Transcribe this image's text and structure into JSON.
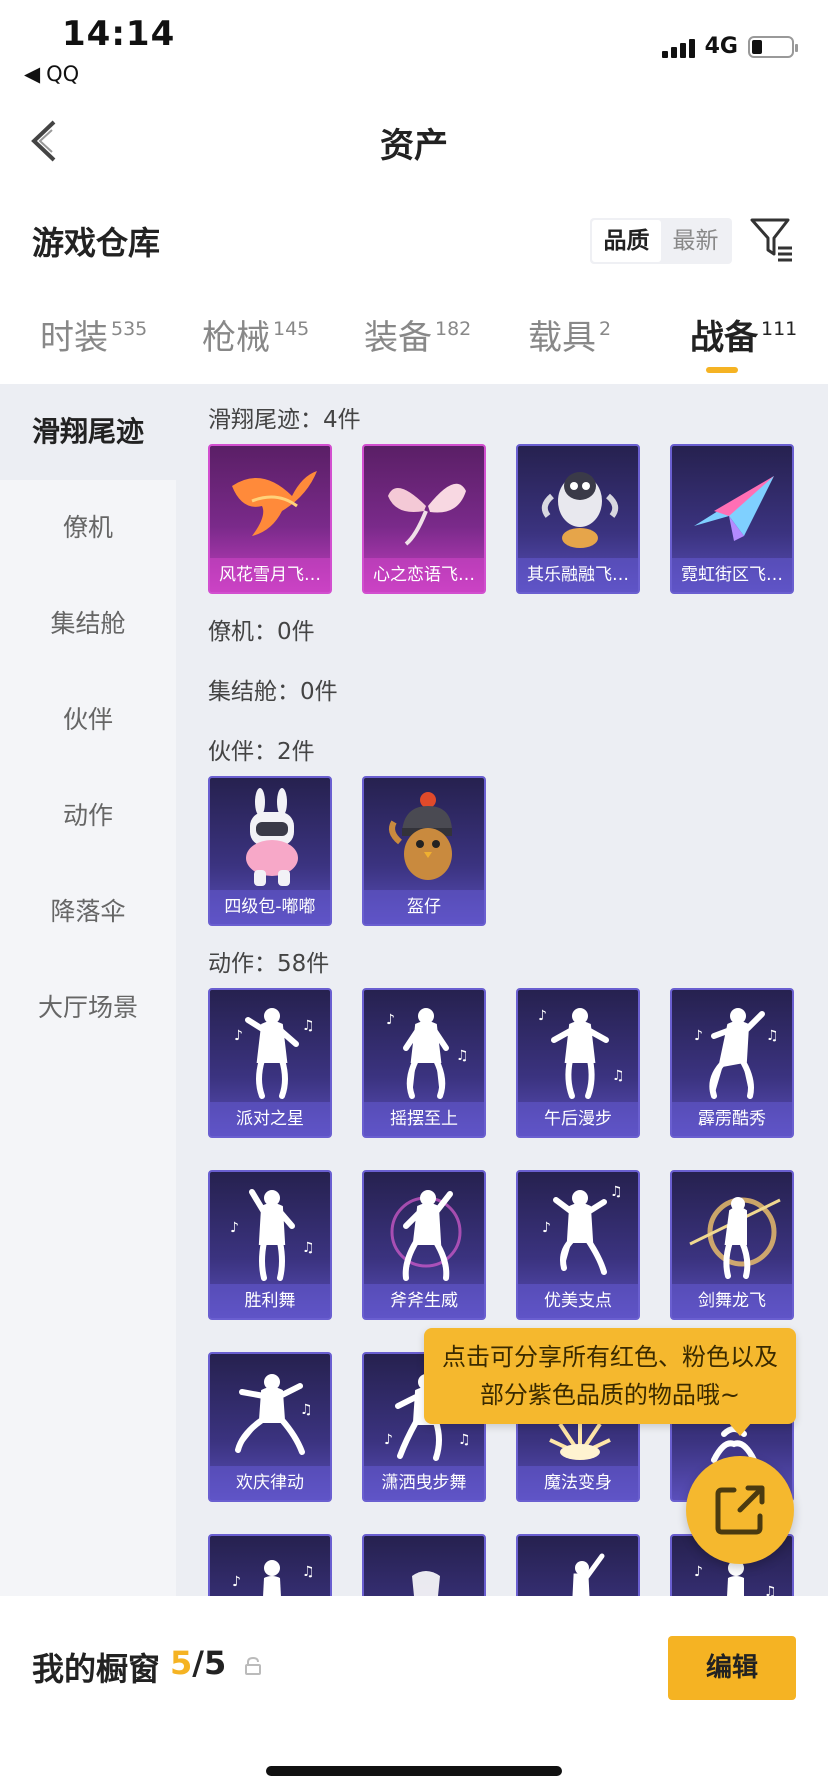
{
  "status": {
    "time": "14:14",
    "back_app": "QQ",
    "network": "4G"
  },
  "nav": {
    "title": "资产"
  },
  "header": {
    "title": "游戏仓库",
    "sort_options": [
      "品质",
      "最新"
    ]
  },
  "tabs": [
    {
      "label": "时装",
      "count": "535"
    },
    {
      "label": "枪械",
      "count": "145"
    },
    {
      "label": "装备",
      "count": "182"
    },
    {
      "label": "载具",
      "count": "2"
    },
    {
      "label": "战备",
      "count": "111"
    }
  ],
  "sidebar": {
    "items": [
      "滑翔尾迹",
      "僚机",
      "集结舱",
      "伙伴",
      "动作",
      "降落伞",
      "大厅场景"
    ]
  },
  "sections": {
    "trail": {
      "label": "滑翔尾迹：4件",
      "items": [
        "风花雪月飞…",
        "心之恋语飞…",
        "其乐融融飞…",
        "霓虹街区飞…"
      ]
    },
    "wingman": {
      "label": "僚机：0件"
    },
    "pod": {
      "label": "集结舱：0件"
    },
    "companion": {
      "label": "伙伴：2件",
      "items": [
        "四级包-嘟嘟",
        "盔仔"
      ]
    },
    "emote": {
      "label": "动作：58件",
      "items": [
        "派对之星",
        "摇摆至上",
        "午后漫步",
        "霹雳酷秀",
        "胜利舞",
        "斧斧生威",
        "优美支点",
        "剑舞龙飞",
        "欢庆律动",
        "潇洒曳步舞",
        "魔法变身"
      ]
    }
  },
  "tooltip": {
    "line1": "点击可分享所有红色、粉色以及",
    "line2": "部分紫色品质的物品哦~"
  },
  "bottom": {
    "label": "我的橱窗",
    "current": "5",
    "total": "/5",
    "edit": "编辑"
  },
  "colors": {
    "accent": "#f5b323",
    "pink_card": "#c33fc0",
    "purple_card": "#5a4fba"
  }
}
